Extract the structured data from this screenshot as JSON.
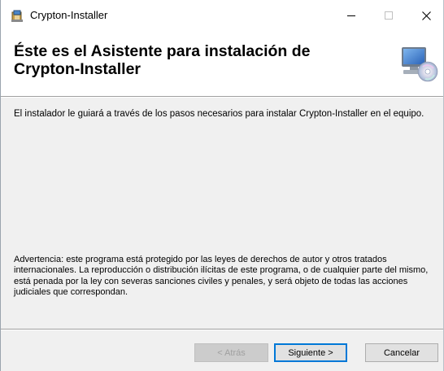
{
  "window": {
    "title": "Crypton-Installer",
    "app_icon": "installer-icon",
    "controls": {
      "minimize_icon": "minimize-icon",
      "maximize_icon": "maximize-icon",
      "close_icon": "close-icon"
    }
  },
  "header": {
    "title": "Éste es el Asistente para instalación de Crypton-Installer",
    "icon": "computer-cd-icon"
  },
  "content": {
    "intro": "El instalador le guiará a través de los pasos necesarios para instalar Crypton-Installer en el equipo.",
    "warning": "Advertencia: este programa está protegido por las leyes de derechos de autor y otros tratados internacionales. La reproducción o distribución ilícitas de este programa, o de cualquier parte del mismo, está penada por la ley con severas sanciones civiles y penales, y será objeto de todas las acciones judiciales que correspondan."
  },
  "buttons": {
    "back": "< Atrás",
    "next": "Siguiente >",
    "cancel": "Cancelar"
  },
  "colors": {
    "accent": "#0078d7",
    "dialog_bg": "#f0f0f0",
    "disabled_text": "#a0a0a0"
  }
}
